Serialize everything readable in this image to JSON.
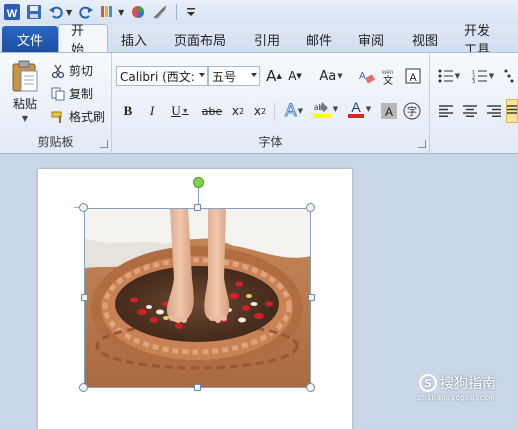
{
  "quick_access": {
    "icons": [
      "word-logo-icon",
      "save-icon",
      "undo-icon",
      "redo-icon",
      "format-painter-icon",
      "color-icon",
      "pen-icon",
      "customize-icon"
    ]
  },
  "tabs": {
    "file": "文件",
    "items": [
      "开始",
      "插入",
      "页面布局",
      "引用",
      "邮件",
      "审阅",
      "视图",
      "开发工具"
    ],
    "active_index": 0
  },
  "clipboard": {
    "paste_label": "粘贴",
    "cut_label": "剪切",
    "copy_label": "复制",
    "format_painter_label": "格式刷",
    "group_title": "剪贴板"
  },
  "font": {
    "font_name": "Calibri (西文:",
    "font_size": "五号",
    "grow": "A",
    "shrink": "A",
    "case": "Aa",
    "bold": "B",
    "italic": "I",
    "underline": "U",
    "strike": "abe",
    "subscript": "x",
    "sub_mark": "2",
    "superscript": "x",
    "sup_mark": "2",
    "effects": "A",
    "font_color": "A",
    "char_shade": "A",
    "enclose": "字",
    "group_title": "字体"
  },
  "colors": {
    "file_tab": "#1d4fa3",
    "highlight": "#ffff00",
    "font_color_bar": "#e02020"
  },
  "watermark": {
    "brand": "搜狗指南",
    "url": "zhinan.sogou.com"
  }
}
